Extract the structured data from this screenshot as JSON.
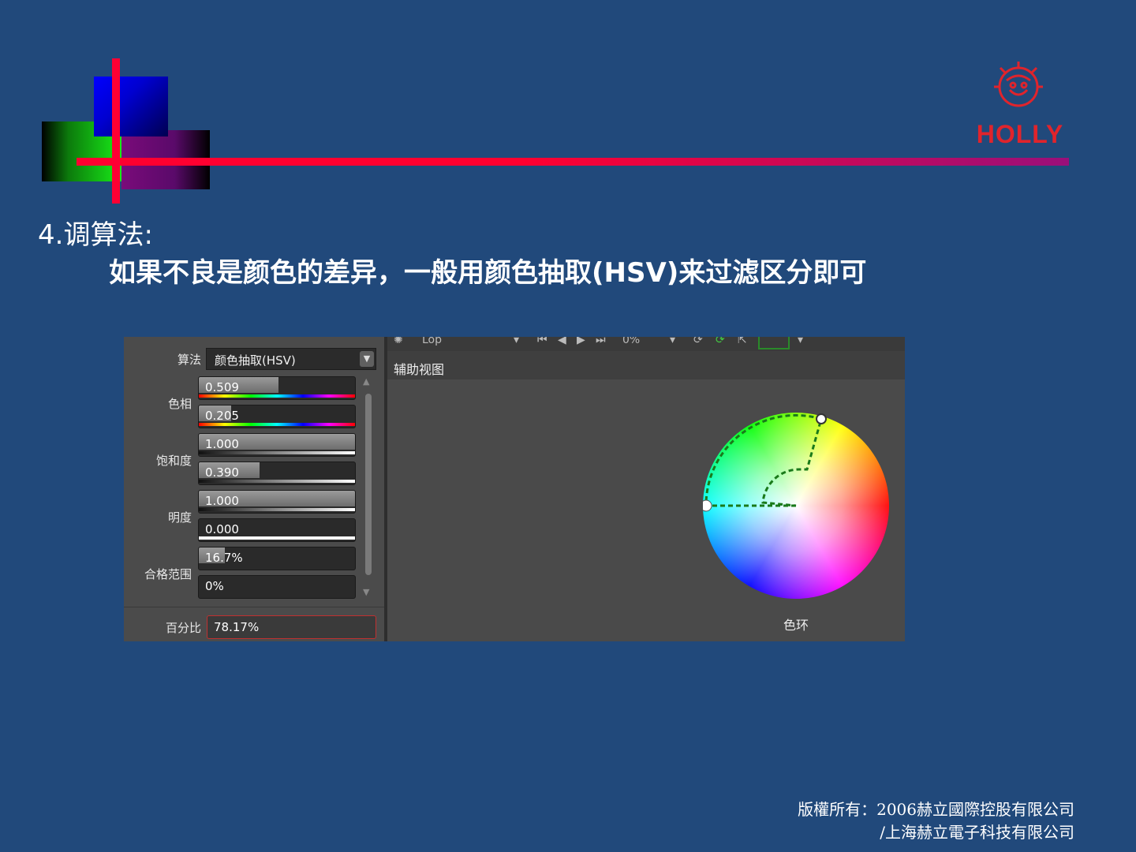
{
  "logo": {
    "text": "HOLLY",
    "color": "#e0242c"
  },
  "heading": "4.调算法:",
  "subheading": "如果不良是颜色的差异，一般用颜色抽取(HSV)来过滤区分即可",
  "screenshot": {
    "toolbar": {
      "top_text": "Lop",
      "percent_text": "0%"
    },
    "algorithm": {
      "label": "算法",
      "value": "颜色抽取(HSV)"
    },
    "groups": [
      {
        "label": "色相"
      },
      {
        "label": "饱和度"
      },
      {
        "label": "明度"
      },
      {
        "label": "合格范围"
      }
    ],
    "sliders": [
      {
        "value": "0.509",
        "fraction": 0.509,
        "bar": "hue"
      },
      {
        "value": "0.205",
        "fraction": 0.205,
        "bar": "hue"
      },
      {
        "value": "1.000",
        "fraction": 1.0,
        "bar": "white"
      },
      {
        "value": "0.390",
        "fraction": 0.39,
        "bar": "white"
      },
      {
        "value": "1.000",
        "fraction": 1.0,
        "bar": "white"
      },
      {
        "value": "0.000",
        "fraction": 0.0,
        "bar": "white"
      },
      {
        "value": "16.7%",
        "fraction": 0.167,
        "bar": "none"
      },
      {
        "value": "0%",
        "fraction": 0.0,
        "bar": "none"
      }
    ],
    "percent": {
      "label": "百分比",
      "value": "78.17%"
    },
    "aux_view": {
      "title": "辅助视图",
      "wheel_label": "色环"
    }
  },
  "footer": {
    "line1": "版權所有：2006赫立國際控股有限公司",
    "line2": "/上海赫立電子科技有限公司"
  }
}
